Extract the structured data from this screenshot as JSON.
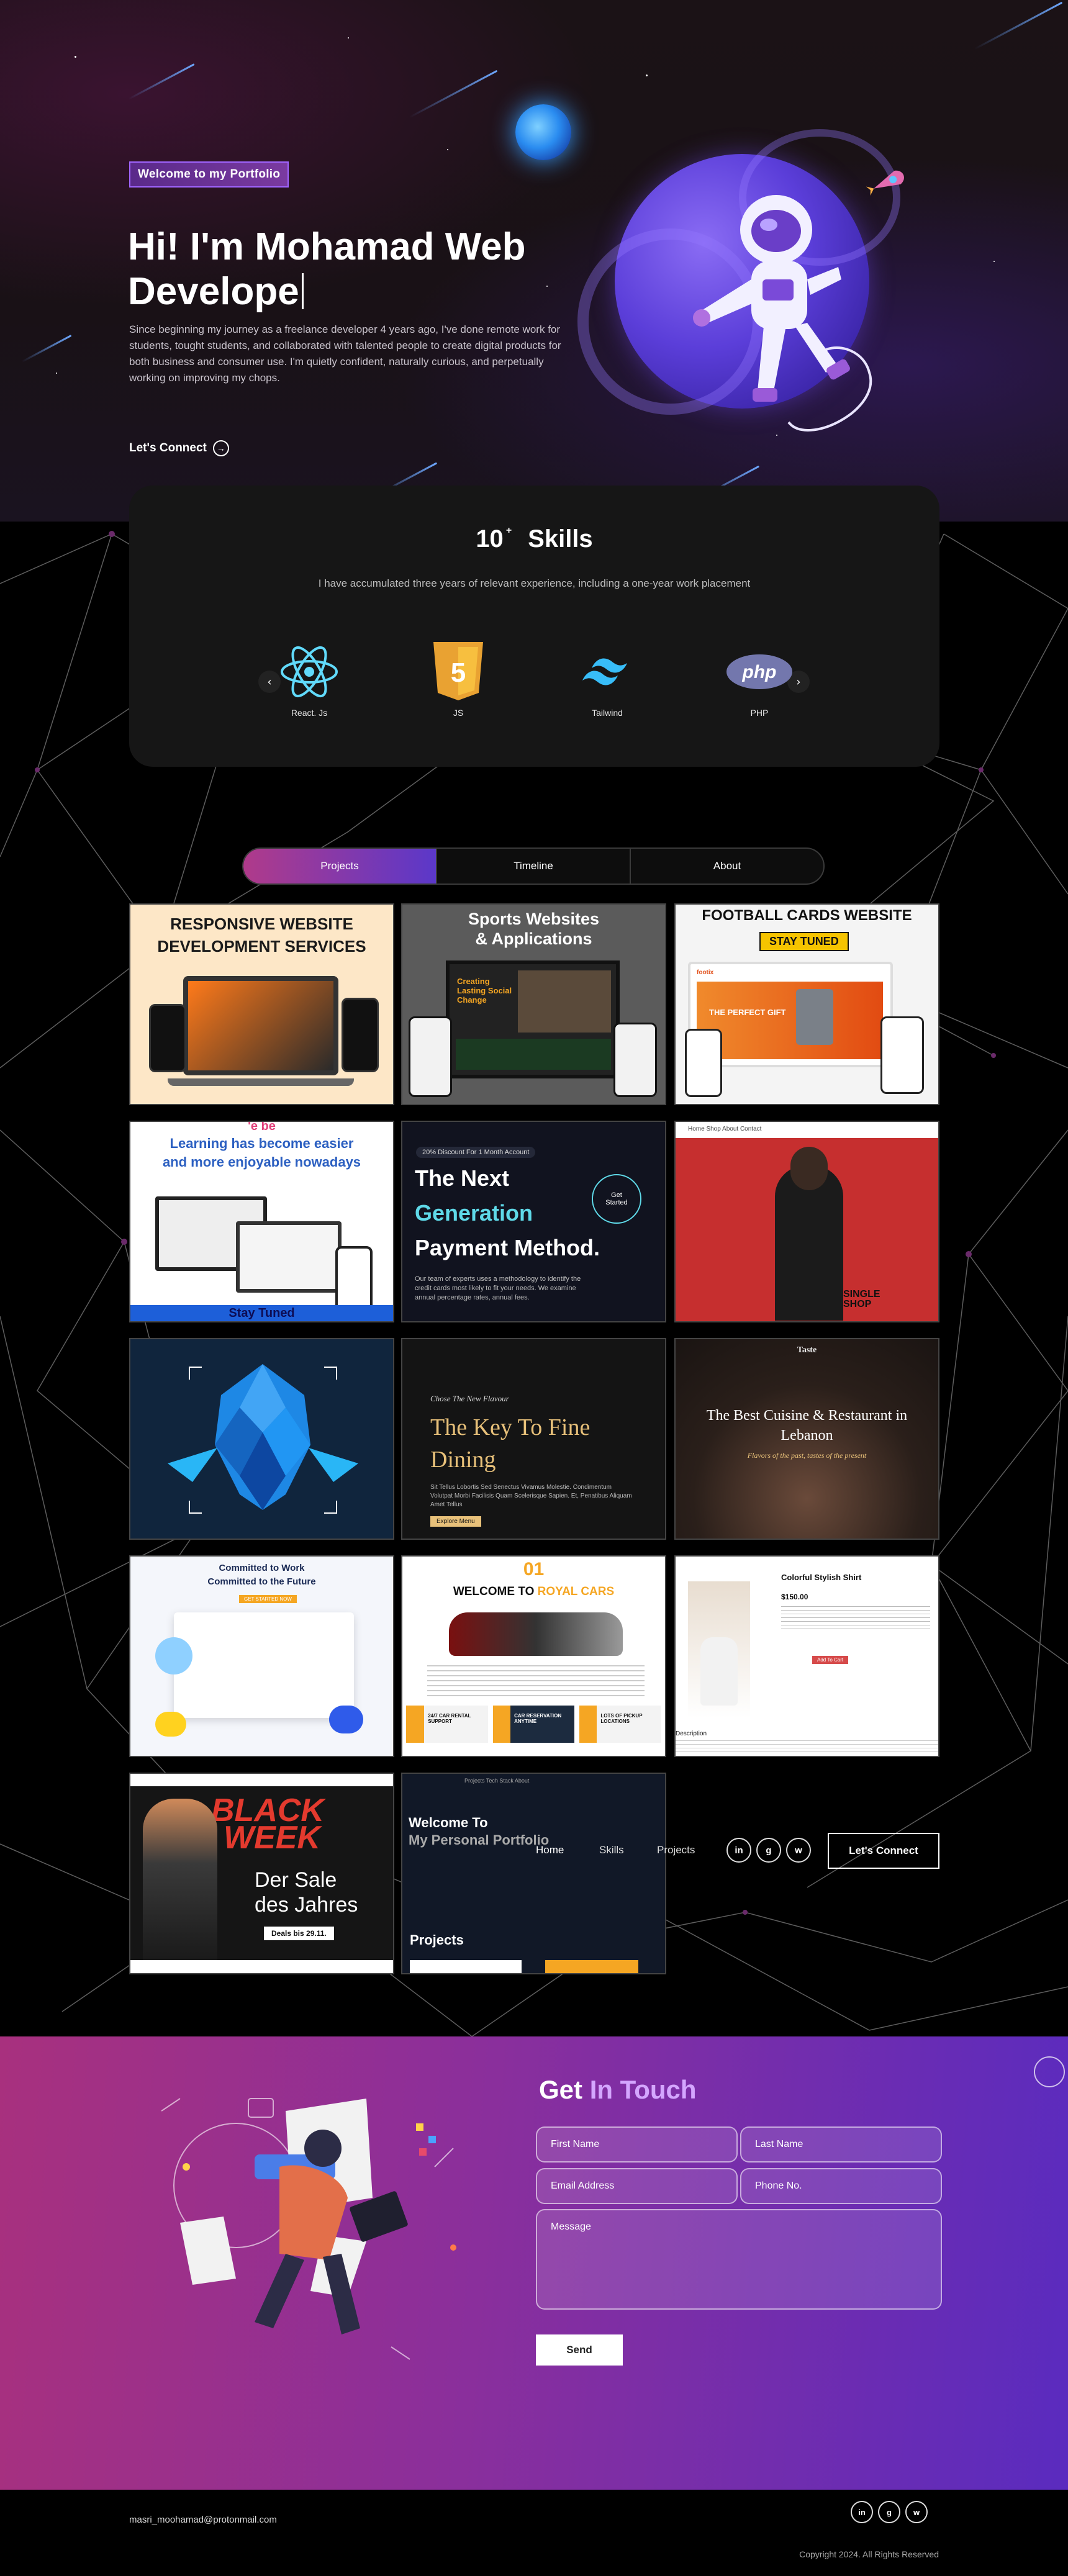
{
  "hero": {
    "badge": "Welcome to my Portfolio",
    "title_line1": "Hi! I'm Mohamad Web",
    "title_line2": "Develope",
    "description": "Since beginning my journey as a freelance developer 4 years ago, I've done remote work for students, tought students, and collaborated with talented people to create digital products for both business and consumer use. I'm quietly confident, naturally curious, and perpetually working on improving my chops.",
    "cta": "Let's Connect"
  },
  "skills": {
    "count": "10",
    "plus": "+",
    "title": "Skills",
    "subtitle": "I have accumulated three years of relevant experience, including a one-year work placement",
    "items": [
      {
        "label": "React. Js",
        "icon": "react-icon"
      },
      {
        "label": "JS",
        "icon": "html5-icon"
      },
      {
        "label": "Tailwind",
        "icon": "tailwind-icon"
      },
      {
        "label": "PHP",
        "icon": "php-icon"
      }
    ],
    "php_logo_text": "php",
    "html_badge": "5"
  },
  "tabs": [
    "Projects",
    "Timeline",
    "About"
  ],
  "projects": {
    "p1": {
      "line1": "RESPONSIVE WEBSITE",
      "line2": "DEVELOPMENT SERVICES"
    },
    "p2": {
      "line1": "Sports Websites",
      "line2": "& Applications",
      "inner": "Creating Lasting Social Change"
    },
    "p3": {
      "title": "FOOTBALL CARDS WEBSITE",
      "badge": "STAY TUNED",
      "brand": "footix",
      "hero": "THE PERFECT GIFT"
    },
    "p4": {
      "top": "'e be",
      "line1": "Learning has become easier",
      "line2": "and more enjoyable nowadays",
      "footer": "Stay Tuned"
    },
    "p5": {
      "promo": "20% Discount For 1 Month Account",
      "line1": "The Next",
      "line2": "Generation",
      "line3": "Payment Method.",
      "desc": "Our team of experts uses a methodology to identify the credit cards most likely to fit your needs. We examine annual percentage rates, annual fees.",
      "cta": "Get Started"
    },
    "p6": {
      "nav": "Home  Shop  About  Contact",
      "watermark": "SINGLE SHOP"
    },
    "p7": {},
    "p8": {
      "kicker": "Chose The New Flavour",
      "line1": "The Key To Fine",
      "line2": "Dining",
      "desc": "Sit Tellus Lobortis Sed Senectus Vivamus Molestie. Condimentum Volutpat Morbi Facilisis Quam Scelerisque Sapien. Et, Penatibus Aliquam Amet Tellus",
      "cta": "Explore Menu"
    },
    "p9": {
      "brand": "Taste",
      "line1": "The Best Cuisine & Restaurant in",
      "line2": "Lebanon",
      "sub": "Flavors of the past, tastes of the present"
    },
    "p10": {
      "line1": "Committed to Work",
      "line2": "Committed to the Future",
      "cta": "GET STARTED NOW"
    },
    "p11": {
      "number": "01",
      "title_a": "WELCOME TO ",
      "title_b": "ROYAL CARS",
      "features": [
        "24/7 CAR RENTAL SUPPORT",
        "CAR RESERVATION ANYTIME",
        "LOTS OF PICKUP LOCATIONS"
      ]
    },
    "p12": {
      "title": "Colorful Stylish Shirt",
      "price": "$150.00",
      "desc_label": "Description",
      "button": "Add To Cart"
    },
    "p13": {
      "line1": "BLACK",
      "line2": "WEEK",
      "sub1": "Der Sale",
      "sub2": "des Jahres",
      "badge": "Deals bis 29.11."
    },
    "p14": {
      "line1": "Welcome To",
      "line2": "My Personal Portfolio",
      "section": "Projects",
      "nav": "Projects  Tech Stack  About"
    }
  },
  "navbar": {
    "items": [
      "Home",
      "Skills",
      "Projects"
    ],
    "social": [
      "in",
      "g",
      "w"
    ],
    "cta": "Let's Connect"
  },
  "contact": {
    "title_a": "Get ",
    "title_b": "In Touch",
    "first_name": "First Name",
    "last_name": "Last Name",
    "email": "Email Address",
    "phone": "Phone No.",
    "message": "Message",
    "send": "Send"
  },
  "footer": {
    "email": "masri_moohamad@protonmail.com",
    "copyright": "Copyright 2024. All Rights Reserved",
    "social": [
      "in",
      "g",
      "w"
    ]
  },
  "colors": {
    "accent_pink": "#b03a8a",
    "accent_purple": "#5b38c9",
    "background": "#000000",
    "card": "#161616"
  }
}
